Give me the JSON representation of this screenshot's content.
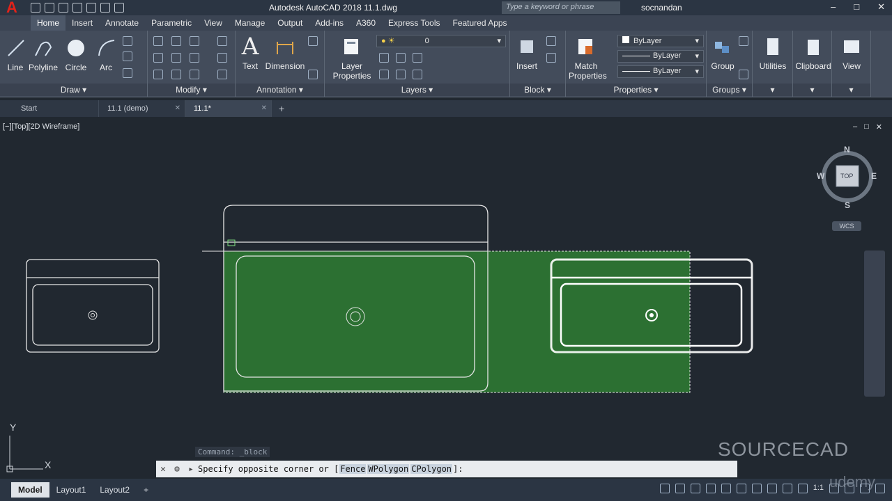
{
  "window": {
    "title": "Autodesk AutoCAD 2018    11.1.dwg",
    "search_placeholder": "Type a keyword or phrase",
    "user": "socnandan"
  },
  "app_menu": {
    "letter": "A"
  },
  "ribbon_tabs": [
    "Home",
    "Insert",
    "Annotate",
    "Parametric",
    "View",
    "Manage",
    "Output",
    "Add-ins",
    "A360",
    "Express Tools",
    "Featured Apps"
  ],
  "ribbon": {
    "draw": {
      "title": "Draw",
      "line": "Line",
      "polyline": "Polyline",
      "circle": "Circle",
      "arc": "Arc"
    },
    "modify": {
      "title": "Modify"
    },
    "annotation": {
      "title": "Annotation",
      "text": "Text",
      "dimension": "Dimension"
    },
    "layers": {
      "title": "Layers",
      "layer_properties_1": "Layer",
      "layer_properties_2": "Properties",
      "current_layer": "0"
    },
    "block": {
      "title": "Block",
      "insert": "Insert"
    },
    "properties": {
      "title": "Properties",
      "match_1": "Match",
      "match_2": "Properties",
      "color": "ByLayer",
      "linetype": "ByLayer",
      "lineweight": "ByLayer"
    },
    "groups": {
      "title": "Groups",
      "group": "Group"
    },
    "utilities": "Utilities",
    "clipboard": "Clipboard",
    "view": "View"
  },
  "doc_tabs": [
    {
      "label": "Start"
    },
    {
      "label": "11.1 (demo)"
    },
    {
      "label": "11.1*"
    }
  ],
  "viewport": {
    "label": "[−][Top][2D Wireframe]",
    "viewcube": {
      "n": "N",
      "s": "S",
      "e": "E",
      "w": "W",
      "top": "TOP",
      "wcs": "WCS"
    },
    "ucs": {
      "x": "X",
      "y": "Y"
    }
  },
  "command": {
    "history": "Command: _block",
    "prompt": "Specify opposite corner or [",
    "options": [
      "Fence",
      "WPolygon",
      "CPolygon"
    ],
    "suffix": "]:"
  },
  "layout_tabs": [
    "Model",
    "Layout1",
    "Layout2"
  ],
  "status": {
    "scale": "1:1"
  },
  "watermark": "SOURCECAD",
  "udemy": "udemy",
  "colors": {
    "selection_fill": "#2e7d32",
    "accent": "#e2231a"
  }
}
